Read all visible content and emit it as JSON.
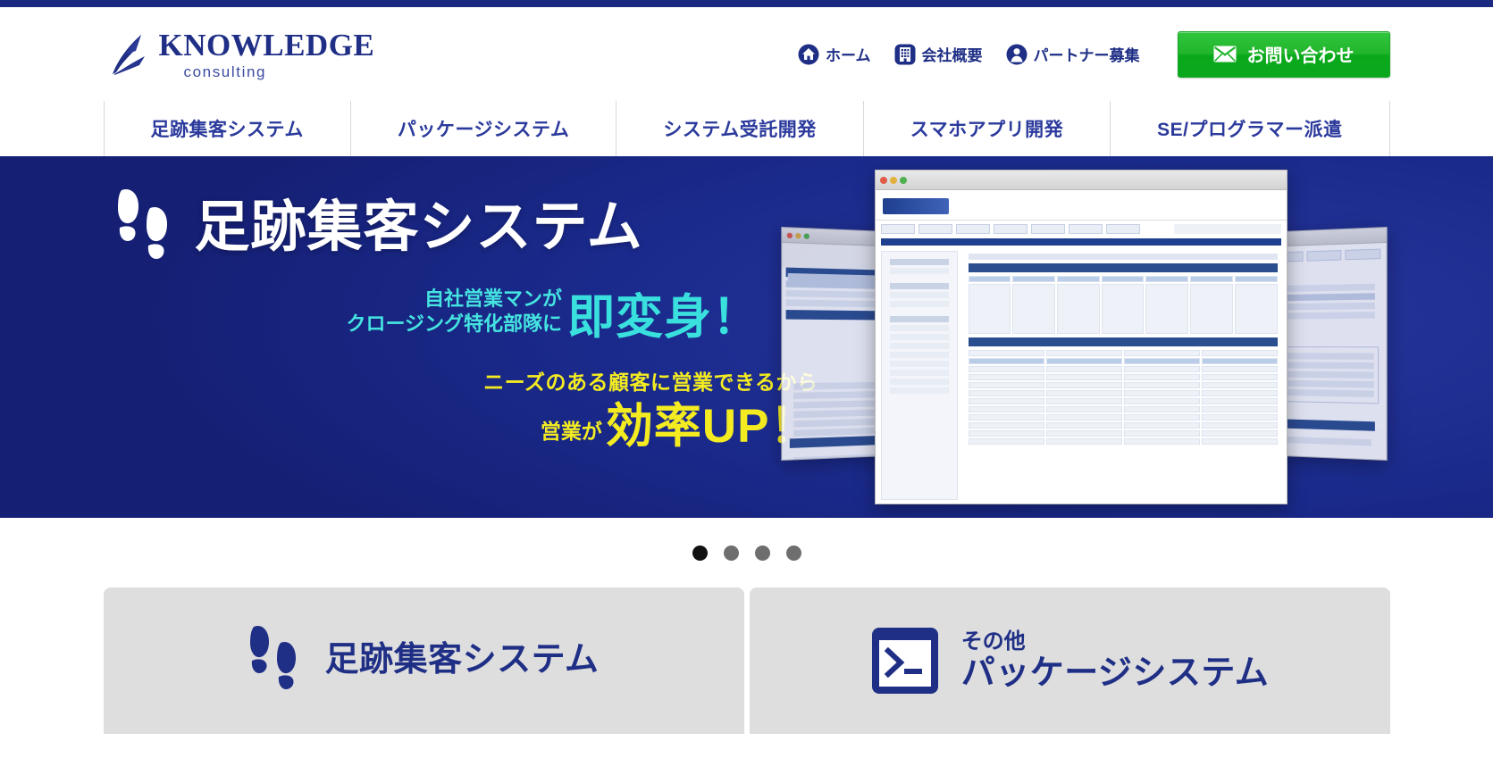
{
  "colors": {
    "brand_blue": "#1f2f86",
    "nav_blue": "#2b3a9c",
    "hero_bg": "#1a2a8c",
    "cta_green": "#1eb42c",
    "cyan": "#39e0dd",
    "yellow": "#f4ec21",
    "card_gray": "#dedede"
  },
  "header": {
    "logo": {
      "mark_icon": "knowledge-arrow-logo-icon",
      "title": "KNOWLEDGE",
      "subtitle": "consulting"
    },
    "util_nav": [
      {
        "label": "ホーム",
        "icon": "home-icon"
      },
      {
        "label": "会社概要",
        "icon": "building-icon"
      },
      {
        "label": "パートナー募集",
        "icon": "person-icon"
      }
    ],
    "contact_button": {
      "label": "お問い合わせ",
      "icon": "mail-icon"
    }
  },
  "main_nav": [
    {
      "label": "足跡集客システム"
    },
    {
      "label": "パッケージシステム"
    },
    {
      "label": "システム受託開発"
    },
    {
      "label": "スマホアプリ開発"
    },
    {
      "label": "SE/プログラマー派遣"
    }
  ],
  "hero": {
    "icon": "footprints-icon",
    "title": "足跡集客システム",
    "copy1_small_line1": "自社営業マンが",
    "copy1_small_line2": "クロージング特化部隊に",
    "copy1_big": "即変身！",
    "copy2_small": "ニーズのある顧客に営業できるから",
    "copy2_pre": "営業が",
    "copy2_big": "効率UP！",
    "screenshot_alt": "システム画面キャプチャ"
  },
  "carousel": {
    "slides": 4,
    "active_index": 0,
    "dots": [
      "1",
      "2",
      "3",
      "4"
    ]
  },
  "cards": [
    {
      "icon": "footprints-icon",
      "sub": "",
      "title": "足跡集客システム"
    },
    {
      "icon": "terminal-icon",
      "sub": "その他",
      "title": "パッケージシステム"
    }
  ]
}
